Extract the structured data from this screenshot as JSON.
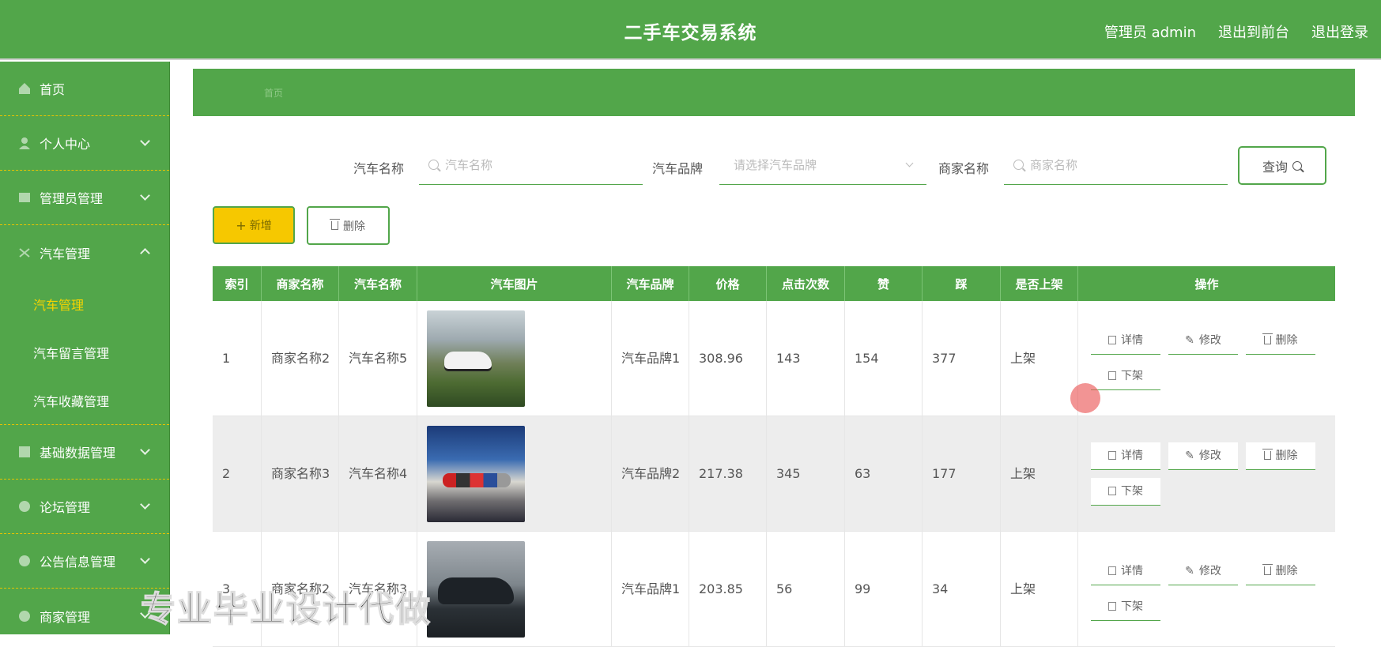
{
  "header": {
    "title": "二手车交易系统",
    "user": "管理员 admin",
    "to_front": "退出到前台",
    "logout": "退出登录"
  },
  "sidebar": {
    "items": [
      {
        "label": "首页"
      },
      {
        "label": "个人中心"
      },
      {
        "label": "管理员管理"
      },
      {
        "label": "汽车管理"
      },
      {
        "label": "基础数据管理"
      },
      {
        "label": "论坛管理"
      },
      {
        "label": "公告信息管理"
      },
      {
        "label": "商家管理"
      }
    ],
    "sub_items": [
      {
        "label": "汽车管理",
        "active": true
      },
      {
        "label": "汽车留言管理"
      },
      {
        "label": "汽车收藏管理"
      }
    ]
  },
  "breadcrumb": "首页",
  "search": {
    "car_name_label": "汽车名称",
    "car_name_placeholder": "汽车名称",
    "brand_label": "汽车品牌",
    "brand_placeholder": "请选择汽车品牌",
    "merchant_label": "商家名称",
    "merchant_placeholder": "商家名称",
    "query_button": "查询"
  },
  "actions": {
    "add": "新增",
    "delete": "删除"
  },
  "table": {
    "headers": [
      "索引",
      "商家名称",
      "汽车名称",
      "汽车图片",
      "汽车品牌",
      "价格",
      "点击次数",
      "赞",
      "踩",
      "是否上架",
      "操作"
    ],
    "rows": [
      {
        "index": "1",
        "merchant": "商家名称2",
        "car": "汽车名称5",
        "brand": "汽车品牌1",
        "price": "308.96",
        "clicks": "143",
        "likes": "154",
        "dislikes": "377",
        "on_shelf": "上架"
      },
      {
        "index": "2",
        "merchant": "商家名称3",
        "car": "汽车名称4",
        "brand": "汽车品牌2",
        "price": "217.38",
        "clicks": "345",
        "likes": "63",
        "dislikes": "177",
        "on_shelf": "上架"
      },
      {
        "index": "3",
        "merchant": "商家名称2",
        "car": "汽车名称3",
        "brand": "汽车品牌1",
        "price": "203.85",
        "clicks": "56",
        "likes": "99",
        "dislikes": "34",
        "on_shelf": "上架"
      }
    ],
    "op_labels": {
      "detail": "详情",
      "edit": "修改",
      "delete": "删除",
      "unshelf": "下架"
    }
  },
  "watermark": "专业毕业设计代做"
}
